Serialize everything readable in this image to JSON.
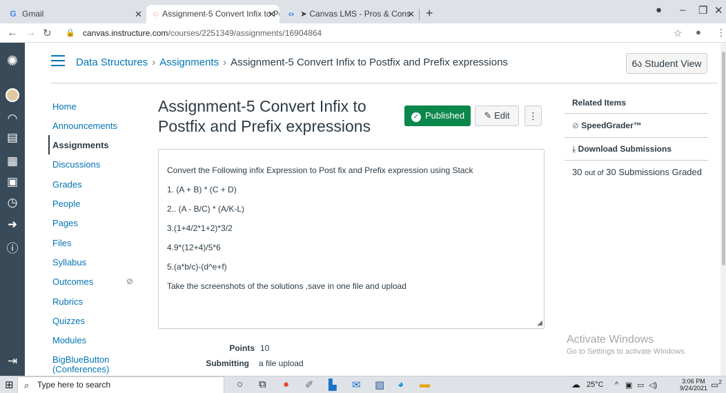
{
  "browser": {
    "tabs": [
      {
        "icon": "gmail-icon",
        "label": "Gmail"
      },
      {
        "icon": "canvas-icon",
        "label": "Assignment-5 Convert Infix to Po"
      },
      {
        "icon": "link-icon",
        "label": "➤ Canvas LMS - Pros & Cons"
      }
    ],
    "url_domain": "canvas.instructure.com",
    "url_path": "/courses/2251349/assignments/16904864"
  },
  "breadcrumb": {
    "course": "Data Structures",
    "section": "Assignments",
    "current": "Assignment-5 Convert Infix to Postfix and Prefix expressions"
  },
  "student_view_label": "Student View",
  "course_nav": [
    {
      "label": "Home",
      "active": false
    },
    {
      "label": "Announcements",
      "active": false
    },
    {
      "label": "Assignments",
      "active": true
    },
    {
      "label": "Discussions",
      "active": false
    },
    {
      "label": "Grades",
      "active": false
    },
    {
      "label": "People",
      "active": false
    },
    {
      "label": "Pages",
      "active": false
    },
    {
      "label": "Files",
      "active": false
    },
    {
      "label": "Syllabus",
      "active": false
    },
    {
      "label": "Outcomes",
      "active": false,
      "hidden": true
    },
    {
      "label": "Rubrics",
      "active": false
    },
    {
      "label": "Quizzes",
      "active": false
    },
    {
      "label": "Modules",
      "active": false
    },
    {
      "label": "BigBlueButton",
      "active": false
    },
    {
      "label": "(Conferences)",
      "active": false
    }
  ],
  "assignment": {
    "title": "Assignment-5 Convert Infix to Postfix and Prefix expressions",
    "published_label": "Published",
    "edit_label": "Edit",
    "more_label": "⋮",
    "description": [
      "Convert the Following infix Expression to Post fix and Prefix expression using Stack",
      "1. (A + B) * (C + D)",
      "2.. (A - B/C) * (A/K-L)",
      "3.(1+4/2*1+2)*3/2",
      "4.9*(12+4)/5*6",
      "5.(a*b/c)-(d^e+f)",
      "Take the screenshots of the solutions ,save in one file and upload"
    ],
    "points_label": "Points",
    "points_value": "10",
    "submitting_label": "Submitting",
    "submitting_value": "a file upload"
  },
  "related": {
    "heading": "Related Items",
    "speedgrader": "SpeedGrader™",
    "download": "Download Submissions",
    "graded_count": "30",
    "graded_out_of": "out of",
    "graded_text": "30 Submissions Graded"
  },
  "watermark": {
    "line1": "Activate Windows",
    "line2": "Go to Settings to activate Windows."
  },
  "taskbar": {
    "search_placeholder": "Type here to search",
    "temperature": "25°C",
    "time": "3:06 PM",
    "date": "9/24/2021",
    "notifications": "2"
  },
  "colors": {
    "brand_blue": "#0374b5",
    "published_green": "#0b874b",
    "global_nav": "#394b58"
  }
}
